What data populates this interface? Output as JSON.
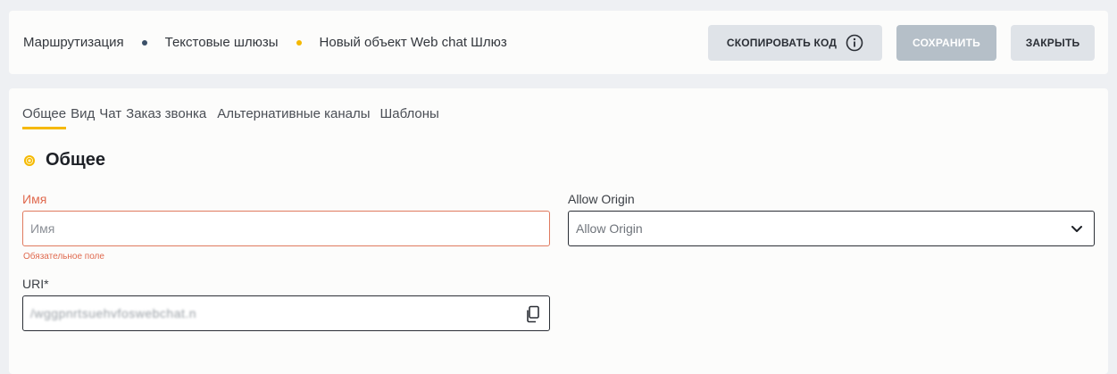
{
  "breadcrumb": {
    "items": [
      "Маршрутизация",
      "Текстовые шлюзы",
      "Новый объект Web chat Шлюз"
    ],
    "separator_colors": [
      "#3b5068",
      "#f5b800"
    ]
  },
  "toolbar": {
    "copy_code_label": "СКОПИРОВАТЬ КОД",
    "save_label": "СОХРАНИТЬ",
    "close_label": "ЗАКРЫТЬ"
  },
  "tabs": [
    {
      "label": "Общее",
      "active": true
    },
    {
      "label": "Вид"
    },
    {
      "label": "Чат"
    },
    {
      "label": "Заказ звонка"
    },
    {
      "label": "Альтернативные каналы"
    },
    {
      "label": "Шаблоны"
    }
  ],
  "section": {
    "title": "Общее"
  },
  "form": {
    "name": {
      "label": "Имя",
      "placeholder": "Имя",
      "error": "Обязательное поле"
    },
    "allow_origin": {
      "label": "Allow Origin",
      "placeholder": "Allow Origin"
    },
    "uri": {
      "label": "URI*",
      "value": "/wggpnrtsuehvfoswebchat.n"
    }
  },
  "colors": {
    "accent": "#f5b800",
    "error": "#e06a4f",
    "save_disabled": "#b5bfc8"
  }
}
